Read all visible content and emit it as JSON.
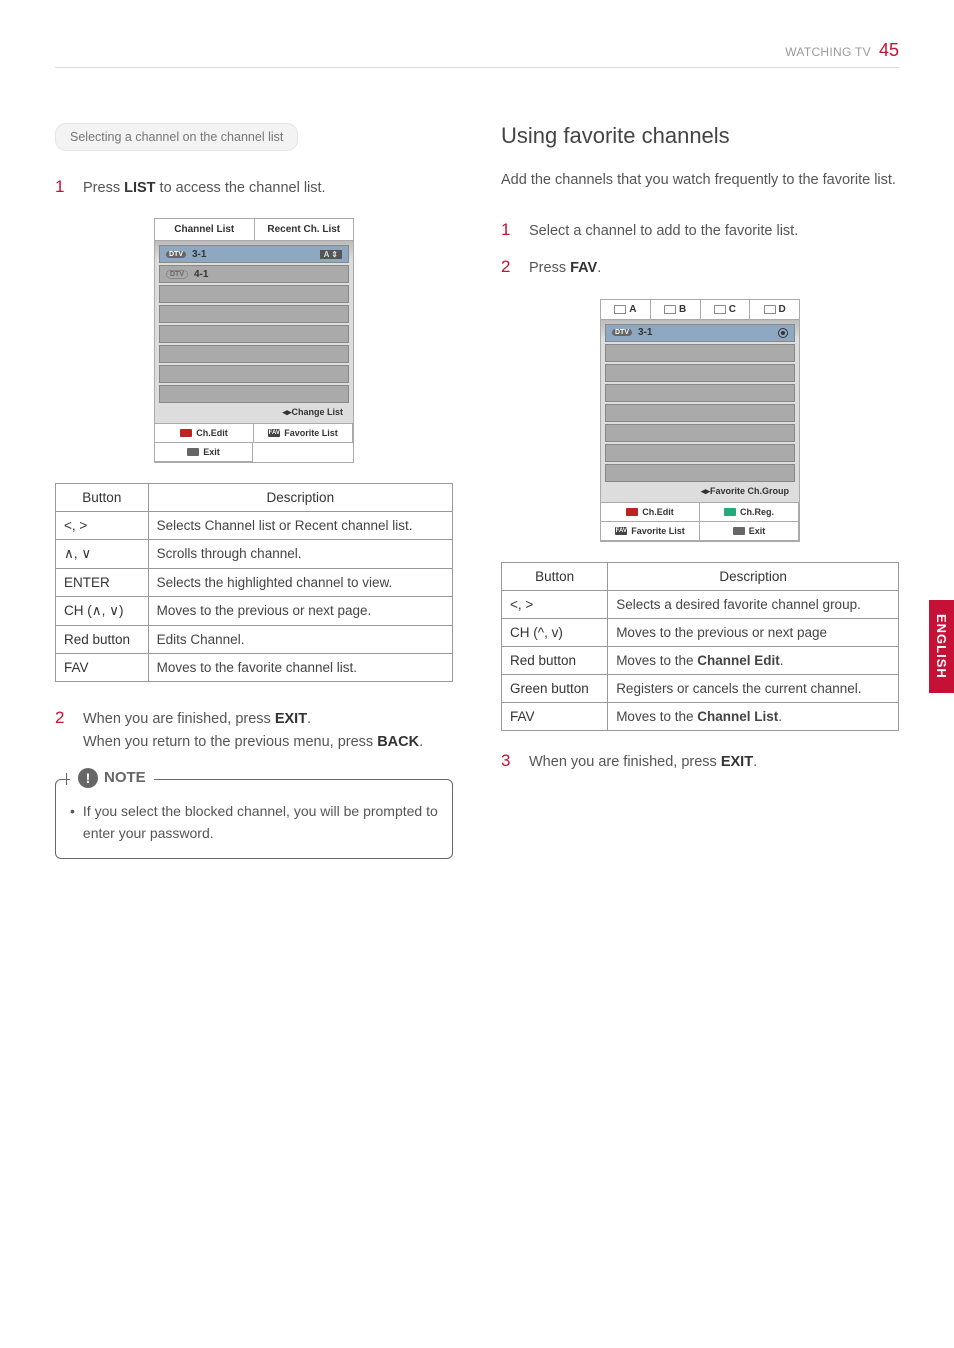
{
  "header": {
    "section": "WATCHING TV",
    "page": "45"
  },
  "side_tab": "ENGLISH",
  "left": {
    "pill": "Selecting a channel on the channel list",
    "step1": {
      "num": "1",
      "pre": "Press ",
      "key": "LIST",
      "post": " to access the channel list."
    },
    "panel": {
      "tabs": [
        "Channel List",
        "Recent Ch. List"
      ],
      "rows": [
        {
          "badge": "DTV",
          "label": "3-1",
          "selected": true,
          "a": "A ⇕"
        },
        {
          "badge": "DTV",
          "label": "4-1",
          "outline": true
        }
      ],
      "caption": "◂▸Change List",
      "footer": [
        {
          "chip": "red",
          "label": "Ch.Edit"
        },
        {
          "chip": "fav",
          "chipText": "FAV",
          "label": "Favorite List"
        },
        {
          "chip": "grey",
          "chipText": "ꜜ",
          "label": "Exit"
        }
      ]
    },
    "table": {
      "head": [
        "Button",
        "Description"
      ],
      "rows": [
        {
          "btn": "<, >",
          "desc": "Selects Channel list or Recent channel list."
        },
        {
          "btn": "∧, ∨",
          "desc": "Scrolls through channel."
        },
        {
          "btn": "ENTER",
          "desc": "Selects the highlighted channel to view."
        },
        {
          "btn": "CH (∧, ∨)",
          "desc": "Moves to the previous or next page."
        },
        {
          "btn": "Red button",
          "desc": "Edits Channel."
        },
        {
          "btn": "FAV",
          "desc": "Moves to the favorite channel list."
        }
      ]
    },
    "step2": {
      "num": "2",
      "l1_pre": "When you are finished, press ",
      "l1_key": "EXIT",
      "l1_post": ".",
      "l2_pre": "When you return to the previous menu, press ",
      "l2_key": "BACK",
      "l2_post": "."
    },
    "note": {
      "title": "NOTE",
      "body": "If you select the blocked channel, you will be prompted to enter your password."
    }
  },
  "right": {
    "h2": "Using favorite channels",
    "intro": "Add the channels that you watch frequently to the favorite list.",
    "step1": {
      "num": "1",
      "text": "Select a channel to add to the favorite list."
    },
    "step2": {
      "num": "2",
      "pre": "Press ",
      "key": "FAV",
      "post": "."
    },
    "panel": {
      "tabs": [
        "A",
        "B",
        "C",
        "D"
      ],
      "rows": [
        {
          "badge": "DTV",
          "label": "3-1",
          "selected": true,
          "radio": true
        }
      ],
      "caption": "◂▸Favorite Ch.Group",
      "footer": [
        {
          "chip": "red",
          "label": "Ch.Edit"
        },
        {
          "chip": "green",
          "label": "Ch.Reg."
        },
        {
          "chip": "fav",
          "chipText": "FAV",
          "label": "Favorite List"
        },
        {
          "chip": "grey",
          "chipText": "ꜜ",
          "label": "Exit"
        }
      ]
    },
    "table": {
      "head": [
        "Button",
        "Description"
      ],
      "rows": [
        {
          "btn": "<, >",
          "desc": "Selects a desired favorite channel group."
        },
        {
          "btn": "CH (^, v)",
          "desc": "Moves to the previous or next page"
        },
        {
          "btn": "Red button",
          "desc_pre": "Moves to the ",
          "desc_b": "Channel Edit",
          "desc_post": "."
        },
        {
          "btn": "Green button",
          "desc": "Registers or cancels the current channel."
        },
        {
          "btn": "FAV",
          "desc_pre": "Moves to the ",
          "desc_b": "Channel List",
          "desc_post": "."
        }
      ]
    },
    "step3": {
      "num": "3",
      "pre": "When you are finished, press ",
      "key": "EXIT",
      "post": "."
    }
  }
}
